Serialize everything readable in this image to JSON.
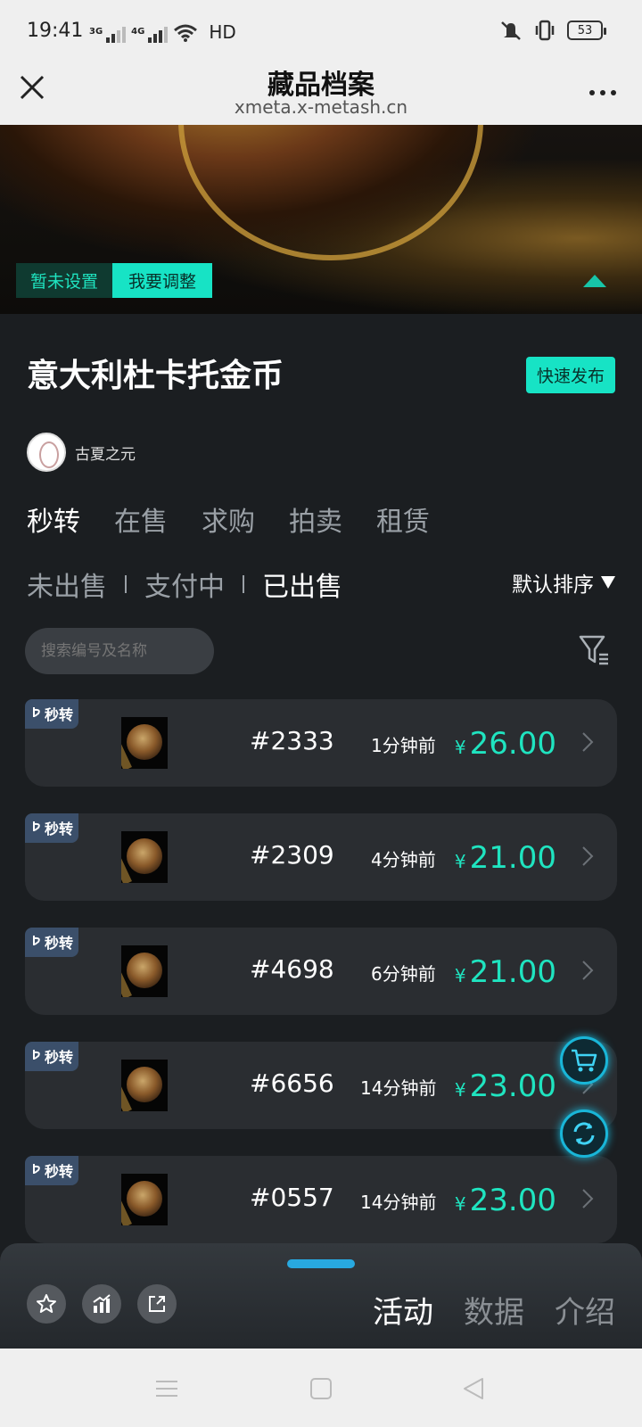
{
  "status": {
    "time": "19:41",
    "net1": "3G",
    "net2": "4G",
    "hd": "HD",
    "battery": "53"
  },
  "header": {
    "title": "藏品档案",
    "url": "xmeta.x-metash.cn"
  },
  "banner": {
    "tag_unset": "暂未设置",
    "tag_adjust": "我要调整"
  },
  "collection": {
    "name": "意大利杜卡托金币",
    "quick_publish": "快速发布",
    "creator": "古夏之元"
  },
  "main_tabs": [
    "秒转",
    "在售",
    "求购",
    "拍卖",
    "租赁"
  ],
  "sub_tabs": [
    "未出售",
    "支付中",
    "已出售"
  ],
  "sort_label": "默认排序",
  "search": {
    "placeholder": "搜索编号及名称"
  },
  "items": [
    {
      "badge": "秒转",
      "number": "#2333",
      "time": "1分钟前",
      "currency": "¥",
      "price": "26.00"
    },
    {
      "badge": "秒转",
      "number": "#2309",
      "time": "4分钟前",
      "currency": "¥",
      "price": "21.00"
    },
    {
      "badge": "秒转",
      "number": "#4698",
      "time": "6分钟前",
      "currency": "¥",
      "price": "21.00"
    },
    {
      "badge": "秒转",
      "number": "#6656",
      "time": "14分钟前",
      "currency": "¥",
      "price": "23.00"
    },
    {
      "badge": "秒转",
      "number": "#0557",
      "time": "14分钟前",
      "currency": "¥",
      "price": "23.00"
    }
  ],
  "bottom_tabs": [
    "活动",
    "数据",
    "介绍"
  ],
  "colors": {
    "accent": "#17e3c5",
    "background": "#1b1e21",
    "card": "#2a2d31",
    "fab": "#19b6d8"
  },
  "icons": [
    "close-icon",
    "more-icon",
    "cart-icon",
    "refresh-icon",
    "filter-icon",
    "star-icon",
    "chart-icon",
    "share-icon",
    "chevron-right-icon"
  ]
}
